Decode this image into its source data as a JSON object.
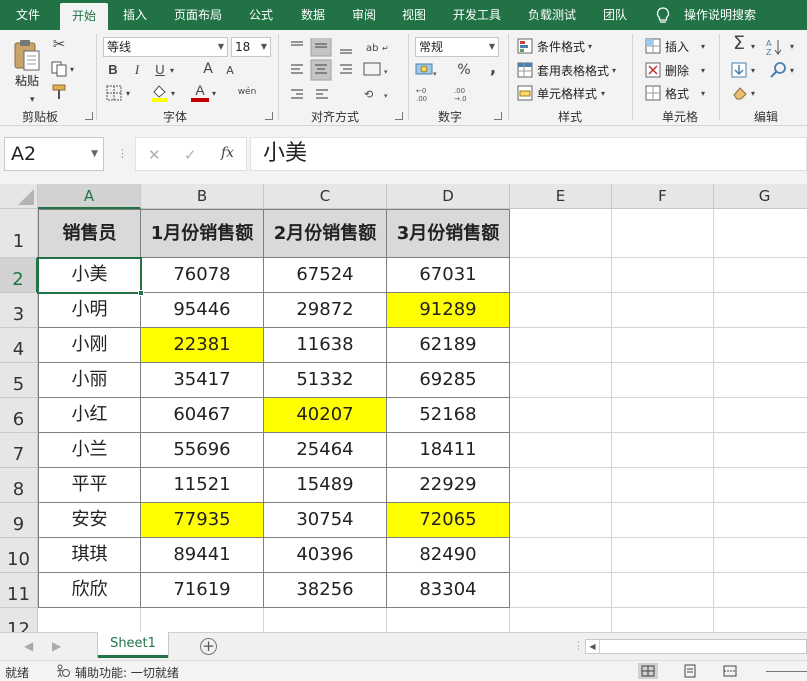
{
  "ribbon_tabs": [
    "文件",
    "开始",
    "插入",
    "页面布局",
    "公式",
    "数据",
    "审阅",
    "视图",
    "开发工具",
    "负载测试",
    "团队",
    "操作说明搜索"
  ],
  "active_tab": "开始",
  "clipboard": {
    "paste": "粘贴",
    "label": "剪贴板"
  },
  "font": {
    "name": "等线",
    "size": "18",
    "label": "字体",
    "bold": "B",
    "italic": "I",
    "underline": "U",
    "grow": "A",
    "shrink": "A",
    "phonetic": "wén"
  },
  "alignment": {
    "label": "对齐方式"
  },
  "number": {
    "format": "常规",
    "label": "数字",
    "percent": "%",
    "comma": ","
  },
  "styles": {
    "conditional": "条件格式",
    "table": "套用表格格式",
    "cell": "单元格样式",
    "label": "样式"
  },
  "cells": {
    "insert": "插入",
    "delete": "删除",
    "format": "格式",
    "label": "单元格"
  },
  "editing": {
    "label": "编辑"
  },
  "formula_bar": {
    "name_box": "A2",
    "content": "小美",
    "fx": "fx"
  },
  "grid": {
    "columns": [
      "A",
      "B",
      "C",
      "D",
      "E",
      "F",
      "G"
    ],
    "rows": [
      "1",
      "2",
      "3",
      "4",
      "5",
      "6",
      "7",
      "8",
      "9",
      "10",
      "11",
      "12"
    ],
    "selected_cell": "A2",
    "headers": [
      "销售员",
      "1月份销售额",
      "2月份销售额",
      "3月份销售额"
    ],
    "data": [
      [
        "小美",
        "76078",
        "67524",
        "67031"
      ],
      [
        "小明",
        "95446",
        "29872",
        "91289"
      ],
      [
        "小刚",
        "22381",
        "11638",
        "62189"
      ],
      [
        "小丽",
        "35417",
        "51332",
        "69285"
      ],
      [
        "小红",
        "60467",
        "40207",
        "52168"
      ],
      [
        "小兰",
        "55696",
        "25464",
        "18411"
      ],
      [
        "平平",
        "11521",
        "15489",
        "22929"
      ],
      [
        "安安",
        "77935",
        "30754",
        "72065"
      ],
      [
        "琪琪",
        "89441",
        "40396",
        "82490"
      ],
      [
        "欣欣",
        "71619",
        "38256",
        "83304"
      ]
    ],
    "highlighted": [
      [
        1,
        3
      ],
      [
        2,
        1
      ],
      [
        4,
        2
      ],
      [
        7,
        1
      ],
      [
        7,
        3
      ]
    ],
    "highlight_color": "#ffff00",
    "header_fill": "#d9d9d9"
  },
  "sheet_tabs": [
    "Sheet1"
  ],
  "status": {
    "ready": "就绪",
    "accessibility": "辅助功能: 一切就绪"
  },
  "colors": {
    "accent": "#217346",
    "font_color": "#c00000",
    "fill_color": "#ffff00"
  }
}
